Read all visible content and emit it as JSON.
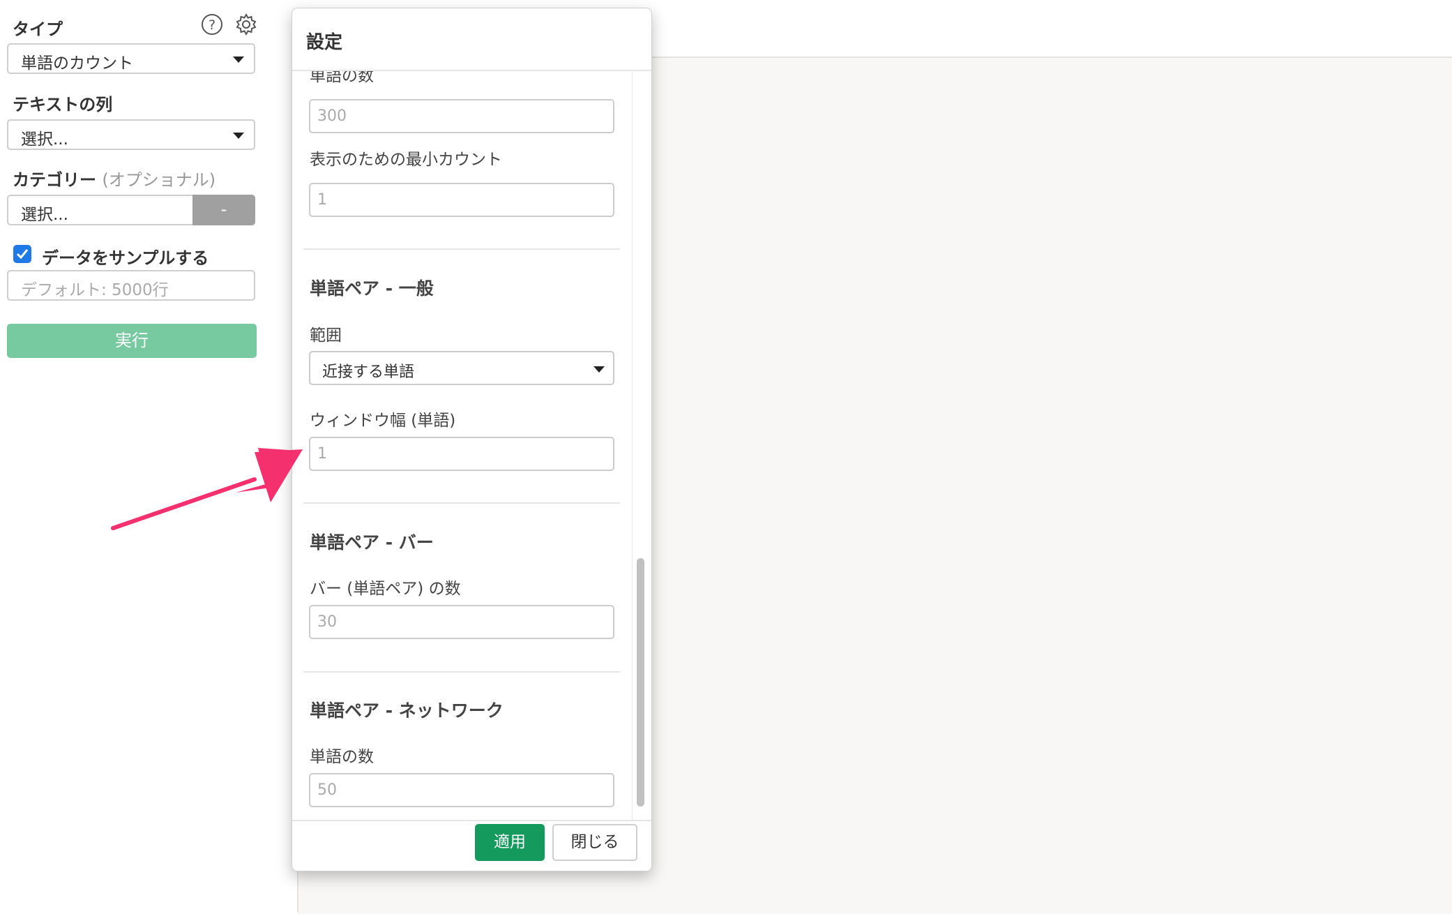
{
  "sidebar": {
    "type_label": "タイプ",
    "type_value": "単語のカウント",
    "text_col_label": "テキストの列",
    "text_col_value": "選択...",
    "category_label": "カテゴリー",
    "category_optional": "(オプショナル)",
    "category_value": "選択...",
    "category_btn": "-",
    "sample_label": "データをサンプルする",
    "sample_checked": true,
    "sample_placeholder": "デフォルト: 5000行",
    "run_label": "実行",
    "icons": [
      "help-icon",
      "gear-icon"
    ]
  },
  "modal": {
    "title": "設定",
    "partial_label": "単語の数",
    "word_count_value": "300",
    "min_count_label": "表示のための最小カウント",
    "min_count_value": "1",
    "pair_general_title": "単語ペア - 一般",
    "range_label": "範囲",
    "range_value": "近接する単語",
    "window_label": "ウィンドウ幅 (単語)",
    "window_value": "1",
    "pair_bar_title": "単語ペア - バー",
    "bars_label": "バー (単語ペア) の数",
    "bars_value": "30",
    "pair_network_title": "単語ペア - ネットワーク",
    "net_words_label": "単語の数",
    "net_words_value": "50",
    "apply_label": "適用",
    "close_label": "閉じる"
  },
  "colors": {
    "apply": "#159a5e",
    "run": "#77c9a0",
    "checkbox": "#1f7ae6",
    "arrow": "#f4306e"
  }
}
